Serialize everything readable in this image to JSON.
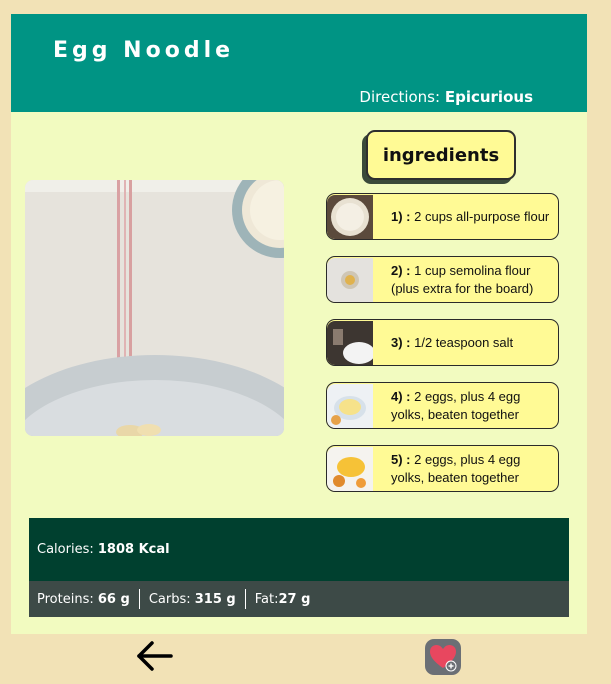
{
  "header": {
    "title": "Egg Noodle",
    "directions_label": "Directions:",
    "directions_source": "Epicurious"
  },
  "ingredients_button": "ingredients",
  "ingredients": [
    {
      "num": "1) :",
      "text": "2 cups all-purpose flour",
      "icon": "flour-bowl-thumbnail"
    },
    {
      "num": "2) :",
      "text": "1 cup semolina flour (plus extra for the board)",
      "icon": "semolina-thumbnail"
    },
    {
      "num": "3) :",
      "text": "1/2 teaspoon salt",
      "icon": "salt-thumbnail"
    },
    {
      "num": "4) :",
      "text": "2 eggs, plus 4 egg yolks, beaten together",
      "icon": "egg-bowl-thumbnail"
    },
    {
      "num": "5) :",
      "text": "2 eggs, plus 4 egg yolks, beaten together",
      "icon": "egg-yolk-thumbnail"
    }
  ],
  "nutrition": {
    "calories_label": "Calories:",
    "calories_value": "1808 Kcal",
    "proteins_label": "Proteins:",
    "proteins_value": "66 g",
    "carbs_label": "Carbs:",
    "carbs_value": "315 g",
    "fat_label": "Fat:",
    "fat_value": "27 g"
  },
  "icons": {
    "back": "back-arrow-icon",
    "favorite": "heart-add-icon"
  },
  "colors": {
    "header": "#009484",
    "card": "#f2fbc0",
    "page": "#f2e2b6",
    "ingredient_bg": "#fffa95",
    "calories_bg": "#00402f",
    "macros_bg": "#3d4a47"
  }
}
